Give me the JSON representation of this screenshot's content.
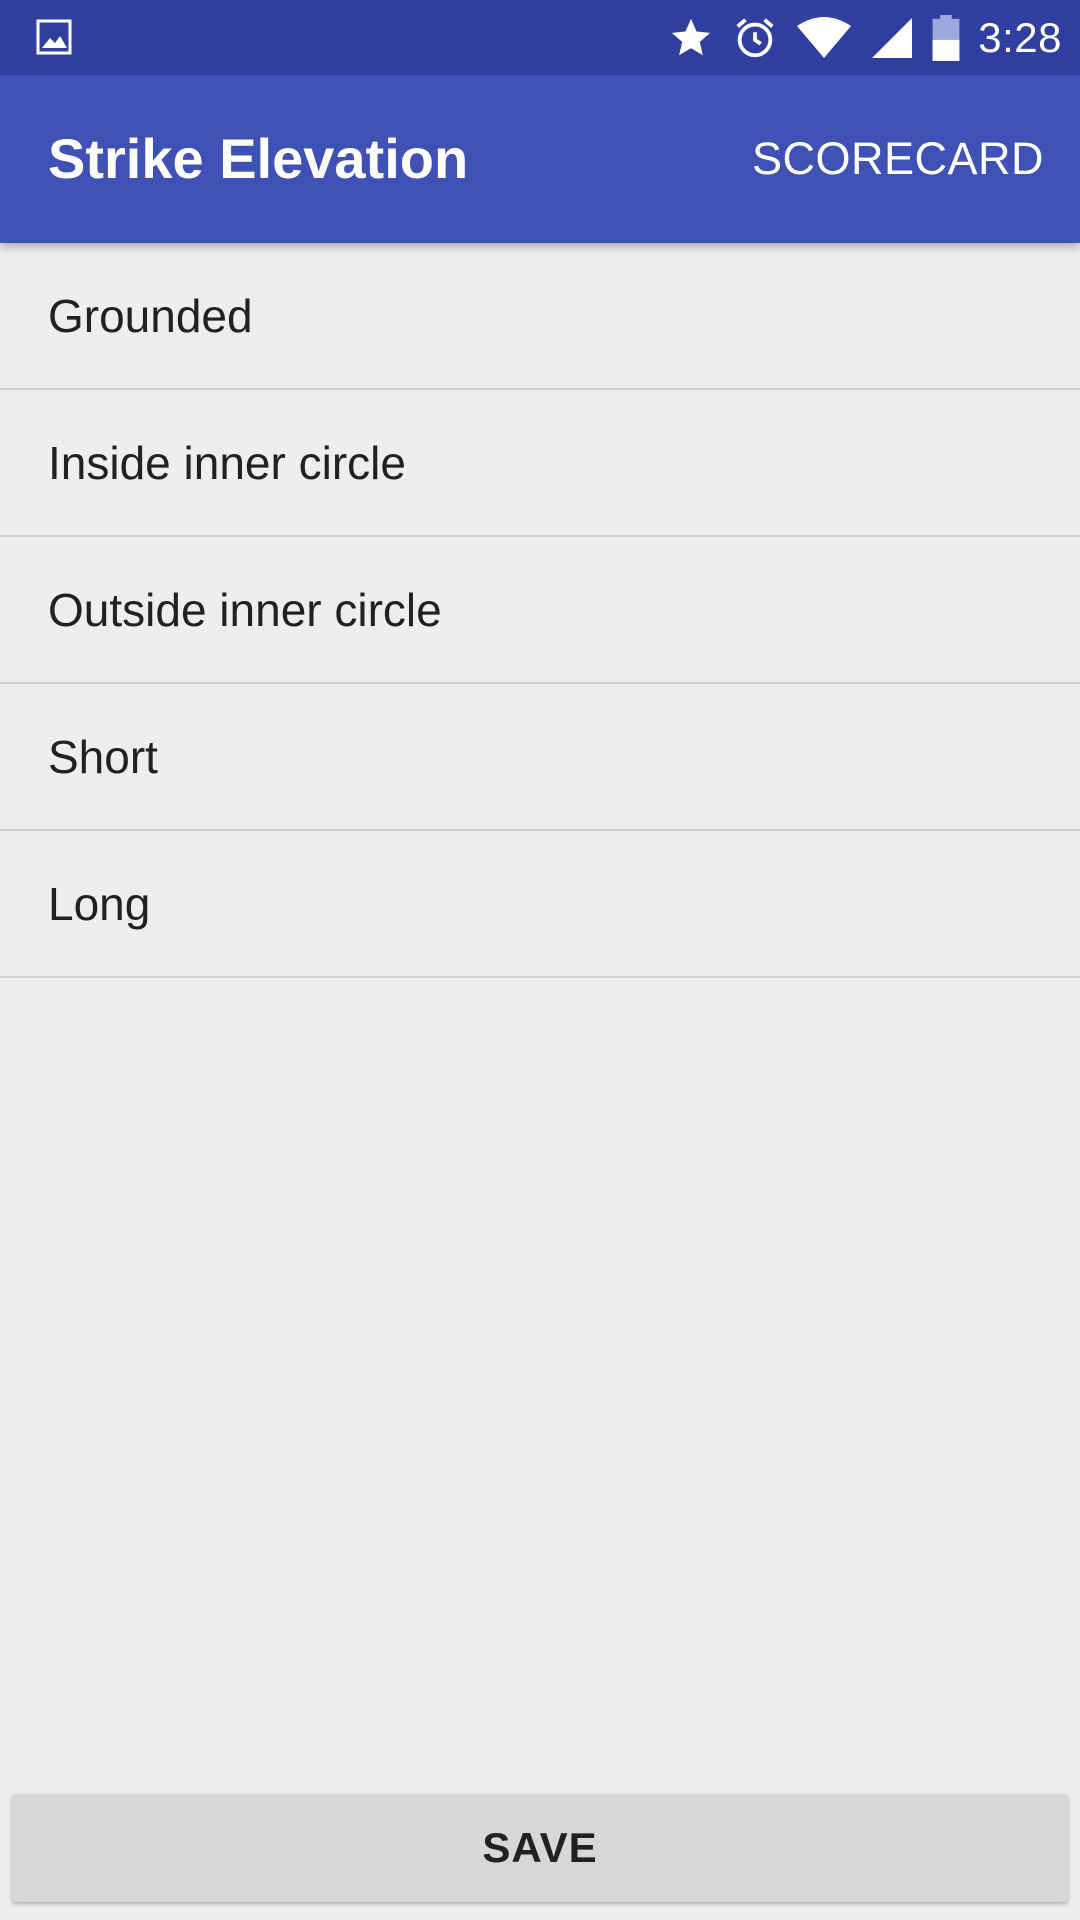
{
  "status_bar": {
    "time": "3:28",
    "icons": [
      "image-icon",
      "star-icon",
      "alarm-icon",
      "wifi-icon",
      "signal-icon",
      "battery-icon"
    ]
  },
  "app_bar": {
    "title": "Strike Elevation",
    "action_label": "SCORECARD"
  },
  "options": [
    {
      "label": "Grounded"
    },
    {
      "label": "Inside inner circle"
    },
    {
      "label": "Outside inner circle"
    },
    {
      "label": "Short"
    },
    {
      "label": "Long"
    }
  ],
  "footer": {
    "save_label": "SAVE"
  },
  "colors": {
    "status_bar": "#303f9f",
    "app_bar": "#3f51b5",
    "background": "#eeeeee",
    "button": "#d6d7d7"
  }
}
